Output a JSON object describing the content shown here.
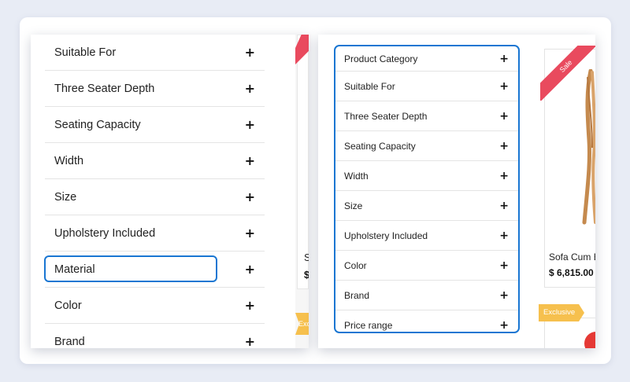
{
  "left_panel": {
    "filters": [
      {
        "label": "Suitable For"
      },
      {
        "label": "Three Seater Depth"
      },
      {
        "label": "Seating Capacity"
      },
      {
        "label": "Width"
      },
      {
        "label": "Size"
      },
      {
        "label": "Upholstery Included"
      },
      {
        "label": "Material"
      },
      {
        "label": "Color"
      },
      {
        "label": "Brand"
      }
    ],
    "plus_glyph": "+",
    "focused_filter": "Material",
    "partial_product_name": "S",
    "partial_product_price": "$",
    "partial_badge": "Exc"
  },
  "right_panel": {
    "filters": [
      {
        "label": "Product Category"
      },
      {
        "label": "Suitable For"
      },
      {
        "label": "Three Seater Depth"
      },
      {
        "label": "Seating Capacity"
      },
      {
        "label": "Width"
      },
      {
        "label": "Size"
      },
      {
        "label": "Upholstery Included"
      },
      {
        "label": "Color"
      },
      {
        "label": "Brand"
      },
      {
        "label": "Price range"
      }
    ],
    "plus_glyph": "+",
    "product": {
      "ribbon": "Sale",
      "name": "Sofa Cum B",
      "price": "$ 6,815.00"
    },
    "badge": "Exclusive"
  },
  "colors": {
    "focus_border": "#1976d2",
    "sale_ribbon": "#e94a5e",
    "exclusive_badge": "#f6c04e"
  }
}
